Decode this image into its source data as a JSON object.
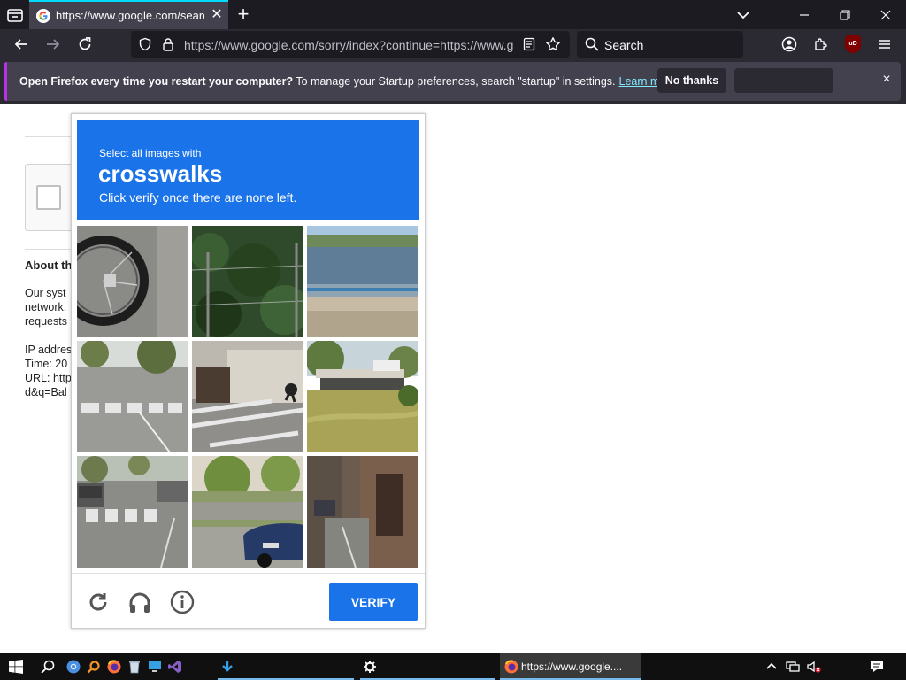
{
  "browser": {
    "tab": {
      "title": "https://www.google.com/search"
    },
    "url": "https://www.google.com/sorry/index?continue=https://www.g",
    "search_placeholder": "Search",
    "ublock_badge": "uD"
  },
  "notification": {
    "bold_text": "Open Firefox every time you restart your computer?",
    "text": " To manage your Startup preferences, search \"startup\" in settings.",
    "link": "Learn more",
    "no_thanks": "No thanks",
    "close": "×"
  },
  "background_page": {
    "about_heading": "About th",
    "lines": [
      "Our syst",
      "network.",
      "requests",
      "",
      "IP addres",
      "Time: 20",
      "URL: http",
      "d&q=Bal"
    ]
  },
  "captcha": {
    "instruction_small": "Select all images with",
    "target": "crosswalks",
    "instruction_sub": "Click verify once there are none left.",
    "tiles": [
      {
        "scene": "bicycle-wheel"
      },
      {
        "scene": "green-fence"
      },
      {
        "scene": "river"
      },
      {
        "scene": "crosswalk-street"
      },
      {
        "scene": "cyclist-crosswalk"
      },
      {
        "scene": "bridge-grass"
      },
      {
        "scene": "crosswalk-cars"
      },
      {
        "scene": "parked-car"
      },
      {
        "scene": "narrow-street"
      }
    ],
    "verify_label": "VERIFY",
    "colors": {
      "header": "#1a73e8",
      "verify": "#1a73e8"
    }
  },
  "taskbar": {
    "active_task": "https://www.google...."
  }
}
